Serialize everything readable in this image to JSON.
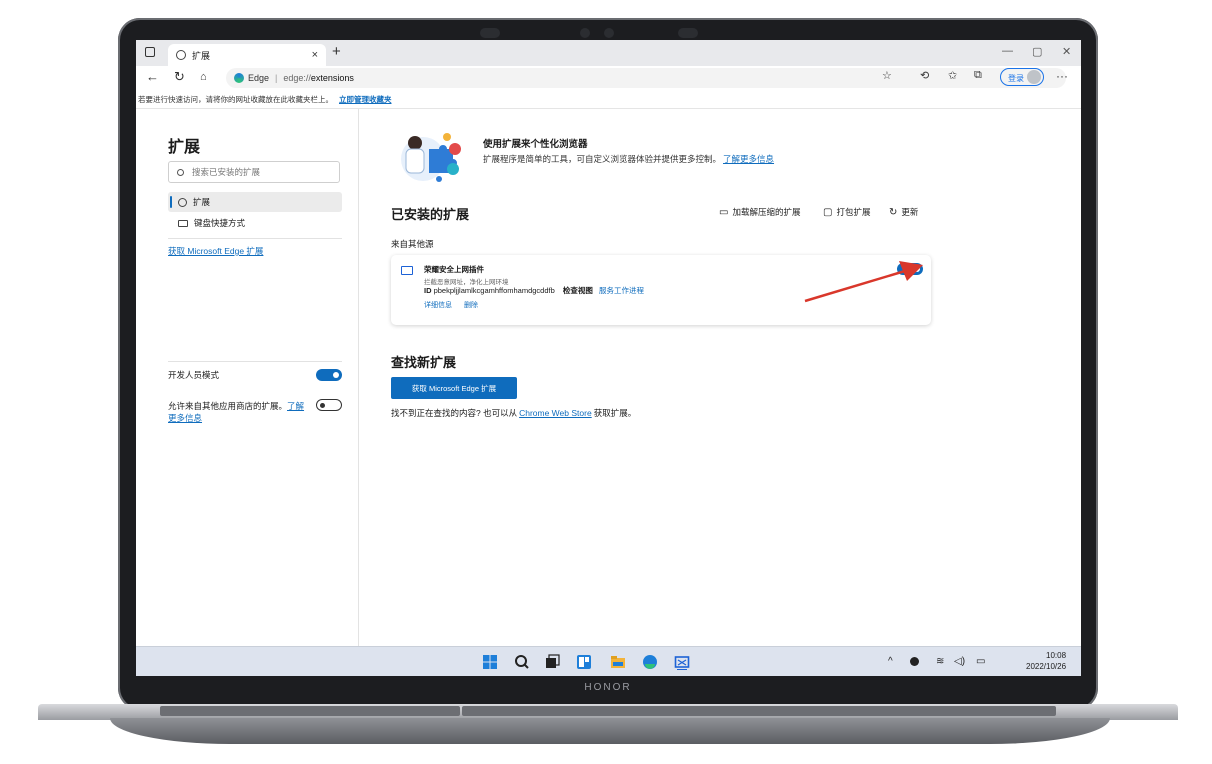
{
  "device": {
    "brand": "HONOR"
  },
  "browser": {
    "tab": {
      "title": "扩展",
      "close": "×"
    },
    "new_tab": "+",
    "window_controls": {
      "minimize": "—",
      "maximize": "▢",
      "close": "✕"
    },
    "address": {
      "site": "Edge",
      "separator": "|",
      "url_prefix": "edge://",
      "url_path": "extensions"
    },
    "login_label": "登录",
    "more": "···",
    "favorites_bar": {
      "text": "若要进行快速访问，请将你的网址收藏放在此收藏夹栏上。",
      "link": "立即管理收藏夹"
    }
  },
  "sidebar": {
    "title": "扩展",
    "search_placeholder": "搜索已安装的扩展",
    "items": [
      {
        "label": "扩展",
        "selected": true
      },
      {
        "label": "键盘快捷方式",
        "selected": false
      }
    ],
    "get_link": "获取 Microsoft Edge 扩展",
    "dev_mode": {
      "label": "开发人员模式",
      "enabled": true
    },
    "allow_other": {
      "text": "允许来自其他应用商店的扩展。",
      "link": "了解更多信息",
      "enabled": false
    }
  },
  "main": {
    "hero": {
      "title": "使用扩展来个性化浏览器",
      "desc": "扩展程序是简单的工具，可自定义浏览器体验并提供更多控制。",
      "link": "了解更多信息"
    },
    "installed_title": "已安装的扩展",
    "actions": [
      {
        "icon": "load-unpacked-icon",
        "label": "加载解压缩的扩展"
      },
      {
        "icon": "pack-icon",
        "label": "打包扩展"
      },
      {
        "icon": "refresh-icon",
        "label": "更新"
      }
    ],
    "other_source": "来自其他源",
    "extension": {
      "name": "荣耀安全上网插件",
      "description": "拦截恶意网址，净化上网环境",
      "id_label": "ID",
      "id_value": "pbekpljjlamlkcgamhffomhamdgcddfb",
      "inspect_label": "检查视图",
      "inspect_link": "服务工作进程",
      "details": "详细信息",
      "remove": "删除",
      "enabled": true
    },
    "find_title": "查找新扩展",
    "get_button": "获取 Microsoft Edge 扩展",
    "cant_find": {
      "before": "找不到正在查找的内容? 也可以从",
      "link": "Chrome Web Store",
      "after": "获取扩展。"
    }
  },
  "taskbar": {
    "apps": [
      "windows-start-icon",
      "search-icon",
      "task-view-icon",
      "widgets-icon",
      "file-explorer-icon",
      "edge-icon",
      "honor-security-icon"
    ],
    "tray": {
      "chevron": "^",
      "wifi": "wifi-icon",
      "volume": "volume-icon",
      "battery": "battery-icon"
    },
    "time": "10:08",
    "date": "2022/10/26"
  },
  "colors": {
    "accent": "#0f6cbd",
    "arrow": "#d9372b"
  }
}
